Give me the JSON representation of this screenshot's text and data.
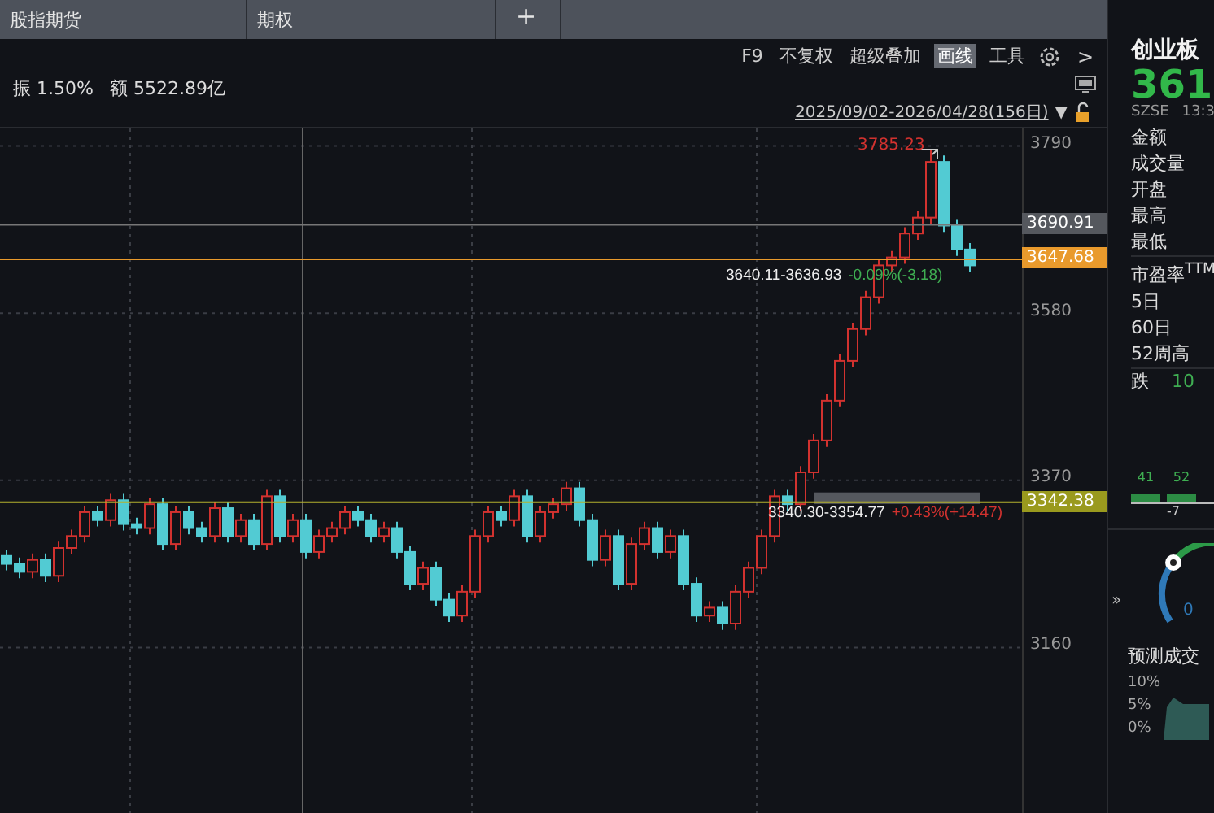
{
  "tabs": [
    {
      "label": "股指期货"
    },
    {
      "label": "期权"
    }
  ],
  "add_tab": "+",
  "quote_stats": [
    {
      "label": "振",
      "value": "1.50%"
    },
    {
      "label": "额",
      "value": "5522.89亿"
    }
  ],
  "toolbar": [
    {
      "label": "F9",
      "selected": false
    },
    {
      "label": "不复权",
      "selected": false
    },
    {
      "label": "超级叠加",
      "selected": false
    },
    {
      "label": "画线",
      "selected": true
    },
    {
      "label": "工具",
      "selected": false
    }
  ],
  "next_button": ">",
  "date_range": "2025/09/02-2026/04/28(156日)",
  "date_dropdown": "▼",
  "chart": {
    "chart_data": {
      "type": "candlestick",
      "yticks": [
        3790,
        3580,
        3370,
        3160
      ],
      "ylim": [
        2950,
        3812
      ],
      "grid": true,
      "ref_lines": [
        {
          "axis": "y",
          "value": 3690.91,
          "label": "3690.91",
          "color": "#777777"
        },
        {
          "axis": "y",
          "value": 3647.68,
          "label": "3647.68",
          "color": "#e99a2c"
        },
        {
          "axis": "y",
          "value": 3342.38,
          "label": "3342.38",
          "color": "#b5b22e"
        }
      ],
      "bands": [
        {
          "axis": "y",
          "from": 3340.3,
          "to": 3354.77,
          "color": "#55585e"
        }
      ],
      "ohlc": [
        [
          3275,
          3283,
          3257,
          3265
        ],
        [
          3265,
          3273,
          3247,
          3255
        ],
        [
          3255,
          3278,
          3247,
          3270
        ],
        [
          3270,
          3278,
          3242,
          3250
        ],
        [
          3250,
          3293,
          3242,
          3285
        ],
        [
          3285,
          3308,
          3277,
          3300
        ],
        [
          3300,
          3338,
          3292,
          3330
        ],
        [
          3330,
          3338,
          3312,
          3320
        ],
        [
          3320,
          3353,
          3312,
          3345
        ],
        [
          3345,
          3353,
          3307,
          3315
        ],
        [
          3315,
          3323,
          3302,
          3310
        ],
        [
          3310,
          3348,
          3302,
          3340
        ],
        [
          3340,
          3348,
          3282,
          3290
        ],
        [
          3290,
          3338,
          3282,
          3330
        ],
        [
          3330,
          3338,
          3302,
          3310
        ],
        [
          3310,
          3318,
          3292,
          3300
        ],
        [
          3300,
          3343,
          3292,
          3335
        ],
        [
          3335,
          3343,
          3292,
          3300
        ],
        [
          3300,
          3328,
          3292,
          3320
        ],
        [
          3320,
          3328,
          3282,
          3290
        ],
        [
          3290,
          3358,
          3282,
          3350
        ],
        [
          3350,
          3358,
          3292,
          3300
        ],
        [
          3300,
          3328,
          3292,
          3320
        ],
        [
          3320,
          3328,
          3272,
          3280
        ],
        [
          3280,
          3308,
          3272,
          3300
        ],
        [
          3300,
          3318,
          3292,
          3310
        ],
        [
          3310,
          3338,
          3302,
          3330
        ],
        [
          3330,
          3338,
          3312,
          3320
        ],
        [
          3320,
          3328,
          3292,
          3300
        ],
        [
          3300,
          3318,
          3292,
          3310
        ],
        [
          3310,
          3318,
          3272,
          3280
        ],
        [
          3280,
          3288,
          3232,
          3240
        ],
        [
          3240,
          3268,
          3232,
          3260
        ],
        [
          3260,
          3268,
          3212,
          3220
        ],
        [
          3220,
          3228,
          3192,
          3200
        ],
        [
          3200,
          3238,
          3192,
          3230
        ],
        [
          3230,
          3308,
          3222,
          3300
        ],
        [
          3300,
          3338,
          3292,
          3330
        ],
        [
          3330,
          3338,
          3312,
          3320
        ],
        [
          3320,
          3358,
          3312,
          3350
        ],
        [
          3350,
          3358,
          3292,
          3300
        ],
        [
          3300,
          3338,
          3292,
          3330
        ],
        [
          3330,
          3348,
          3322,
          3340
        ],
        [
          3340,
          3368,
          3332,
          3360
        ],
        [
          3360,
          3368,
          3312,
          3320
        ],
        [
          3320,
          3328,
          3262,
          3270
        ],
        [
          3270,
          3308,
          3262,
          3300
        ],
        [
          3300,
          3308,
          3232,
          3240
        ],
        [
          3240,
          3298,
          3232,
          3290
        ],
        [
          3290,
          3318,
          3282,
          3310
        ],
        [
          3310,
          3318,
          3272,
          3280
        ],
        [
          3280,
          3308,
          3272,
          3300
        ],
        [
          3300,
          3308,
          3232,
          3240
        ],
        [
          3240,
          3248,
          3192,
          3200
        ],
        [
          3200,
          3218,
          3192,
          3210
        ],
        [
          3210,
          3218,
          3182,
          3190
        ],
        [
          3190,
          3238,
          3182,
          3230
        ],
        [
          3230,
          3268,
          3222,
          3260
        ],
        [
          3260,
          3308,
          3252,
          3300
        ],
        [
          3300,
          3358,
          3292,
          3350
        ],
        [
          3350,
          3358,
          3332,
          3340
        ],
        [
          3340,
          3388,
          3332,
          3380
        ],
        [
          3380,
          3428,
          3372,
          3420
        ],
        [
          3420,
          3478,
          3412,
          3470
        ],
        [
          3470,
          3528,
          3462,
          3520
        ],
        [
          3520,
          3568,
          3512,
          3560
        ],
        [
          3560,
          3608,
          3552,
          3600
        ],
        [
          3600,
          3648,
          3592,
          3640
        ],
        [
          3640,
          3658,
          3632,
          3650
        ],
        [
          3650,
          3688,
          3642,
          3680
        ],
        [
          3680,
          3708,
          3672,
          3700
        ],
        [
          3700,
          3785,
          3692,
          3770
        ],
        [
          3770,
          3778,
          3682,
          3690
        ],
        [
          3690,
          3698,
          3652,
          3660
        ],
        [
          3660,
          3668,
          3632,
          3640
        ]
      ]
    },
    "high_label": "3785.23",
    "range_labels": [
      {
        "range": "3640.11-3636.93",
        "change": "-0.09%(-3.18)",
        "color": "#3fae52"
      },
      {
        "range": "3340.30-3354.77",
        "change": "+0.43%(+14.47)",
        "color": "#d2322f"
      }
    ]
  },
  "side_panel": {
    "title": "创业板",
    "price": "361",
    "exchange": "SZSE",
    "time": "13:3",
    "fields": [
      {
        "label": "金额"
      },
      {
        "label": "成交量"
      },
      {
        "label": "开盘"
      },
      {
        "label": "最高"
      },
      {
        "label": "最低"
      },
      {
        "label": "市盈率$^{TTM}$"
      },
      {
        "label": "5日"
      },
      {
        "label": "60日"
      },
      {
        "label": "52周高"
      },
      {
        "label": "跌",
        "value": "10"
      }
    ],
    "bar_values": [
      "41",
      "52"
    ],
    "axis_label": "-7",
    "gauge_labels": [
      "0"
    ],
    "collapse_button": "»",
    "forecast_title": "预测成交",
    "forecast_ticks": [
      "10%",
      "5%",
      "0%"
    ]
  }
}
